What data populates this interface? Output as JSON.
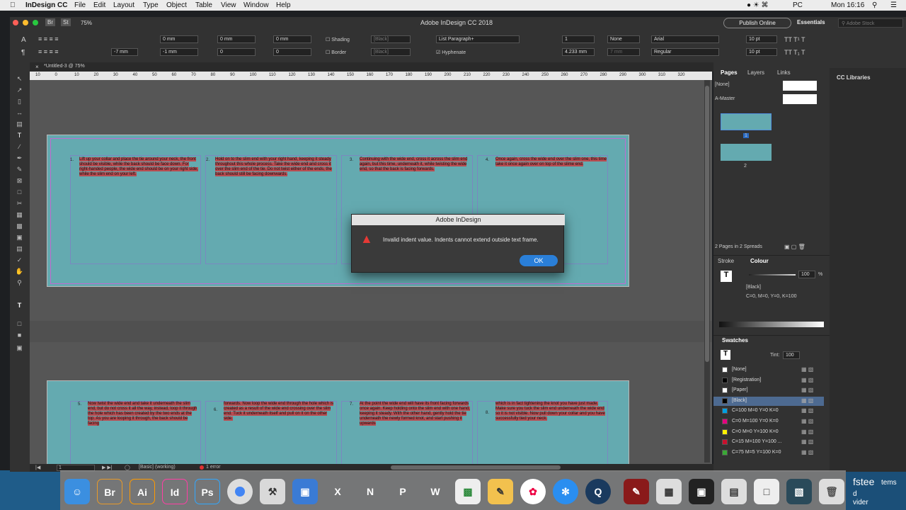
{
  "menubar": {
    "app": "InDesign CC",
    "items": [
      "File",
      "Edit",
      "Layout",
      "Type",
      "Object",
      "Table",
      "View",
      "Window",
      "Help"
    ],
    "right": [
      "PC",
      "Mon 16:16"
    ]
  },
  "app": {
    "title": "Adobe InDesign CC 2018",
    "zoom": "75%",
    "publish": "Publish Online",
    "workspace": "Essentials",
    "search_placeholder": "Adobe Stock"
  },
  "controls": {
    "indent1": "0 mm",
    "indent2": "0 mm",
    "indent3": "0 mm",
    "indent4": "-7 mm",
    "indent5": "-1 mm",
    "indent6": "0",
    "indent7": "0",
    "shading": "Shading",
    "border": "Border",
    "black1": "[Black]",
    "black2": "[Black]",
    "para_style": "List Paragraph+",
    "hyphenate": "Hyphenate",
    "cols": "1",
    "gutter": "4.233 mm",
    "align": "None",
    "span": "7 mm",
    "font": "Arial",
    "style": "Regular",
    "size": "10 pt",
    "leading": "10 pt"
  },
  "tab": {
    "label": "*Untitled-3 @ 75%"
  },
  "ruler": {
    "ticks": [
      "10",
      "0",
      "10",
      "20",
      "30",
      "40",
      "50",
      "60",
      "70",
      "80",
      "90",
      "100",
      "110",
      "120",
      "130",
      "140",
      "150",
      "160",
      "170",
      "180",
      "190",
      "200",
      "210",
      "220",
      "230",
      "240",
      "250",
      "260",
      "270",
      "280",
      "290",
      "300",
      "310",
      "320"
    ]
  },
  "page1": {
    "items": [
      {
        "num": "1.",
        "text": "Lift up your collar and place the tie around your neck, the front should be visible, while the back should be face down. For right-handed people, the wide end should be on your right side, while the slim end on your left."
      },
      {
        "num": "2.",
        "text": "Hold on to the slim end with your right hand, keeping it steady throughout this whole process. Take the wide end and cross it over the slim end of the tie. Do not twist either of the ends, the back should still be facing downwards."
      },
      {
        "num": "3.",
        "text": "Continuing with the wide end, cross it across the slim end again, but this time, underneath it, while twisting the wide end, so that the back is facing forwards."
      },
      {
        "num": "4.",
        "text": "Once again, cross the wide end over the slim one, this time take it once again over on top of the slime end."
      }
    ]
  },
  "page2": {
    "items": [
      {
        "num": "5.",
        "text": "Now twist the wide end and take it underneath the slim end, but do not cross it all the way, instead, loop it through the hole which has been created by the two ends at the top. As you are looping it through, the back should be facing"
      },
      {
        "num": "6.",
        "text": "forwards. Now loop the wide end through the hole which is created as a result of the wide end crossing over the slim end. Tuck it underneath itself and pull on it on the other side."
      },
      {
        "num": "7.",
        "text": "At the point the wide end will have its front facing forwards once again. Keep holding onto the slim end with one hand, keeping it steady. With the other hand, gently hold the tie underneath the newly formed knot, and start pushing it upwards"
      },
      {
        "num": "8.",
        "text": "which is in fact tightening the knot you have just made. Make sure you tuck the slim end underneath the wide end so it is not visible. Now pull down your collar and you have successfully tied your neck."
      }
    ]
  },
  "status": {
    "page": "1",
    "preflight": "[Basic] (working)",
    "errors": "1 error"
  },
  "pages_panel": {
    "tabs": [
      "Pages",
      "Layers",
      "Links"
    ],
    "none": "[None]",
    "master": "A-Master",
    "p1": "1",
    "p2": "2",
    "summary": "2 Pages in 2 Spreads"
  },
  "colour_panel": {
    "tabs": [
      "Stroke",
      "Colour"
    ],
    "tint": "100",
    "pct": "%",
    "name": "[Black]",
    "values": "C=0, M=0, Y=0, K=100"
  },
  "swatches": {
    "title": "Swatches",
    "tint_label": "Tint:",
    "tint": "100",
    "items": [
      {
        "name": "[None]",
        "color": "#ffffff"
      },
      {
        "name": "[Registration]",
        "color": "#000000"
      },
      {
        "name": "[Paper]",
        "color": "#ffffff"
      },
      {
        "name": "[Black]",
        "color": "#000000"
      },
      {
        "name": "C=100 M=0 Y=0 K=0",
        "color": "#00a0e3"
      },
      {
        "name": "C=0 M=100 Y=0 K=0",
        "color": "#e4007f"
      },
      {
        "name": "C=0 M=0 Y=100 K=0",
        "color": "#fff100"
      },
      {
        "name": "C=15 M=100 Y=100 ...",
        "color": "#c8102e"
      },
      {
        "name": "C=75 M=5 Y=100 K=0",
        "color": "#3aa935"
      }
    ]
  },
  "libraries": {
    "title": "CC Libraries"
  },
  "dialog": {
    "title": "Adobe InDesign",
    "message": "Invalid indent value. Indents cannot extend outside text frame.",
    "ok": "OK"
  },
  "dock": {
    "apps": [
      {
        "label": "Br",
        "color": "#2b1a0a"
      },
      {
        "label": "Ai",
        "color": "#2e1400"
      },
      {
        "label": "Id",
        "color": "#3a0a20"
      },
      {
        "label": "Ps",
        "color": "#0a1f33"
      },
      {
        "label": "X",
        "color": "#1e7a3e"
      },
      {
        "label": "N",
        "color": "#7a2f8f"
      },
      {
        "label": "P",
        "color": "#c43b1d"
      },
      {
        "label": "W",
        "color": "#2b579a"
      }
    ]
  },
  "desktop": {
    "text1": "fstee",
    "text2": "d",
    "text3": "vider",
    "text4": "tems"
  }
}
